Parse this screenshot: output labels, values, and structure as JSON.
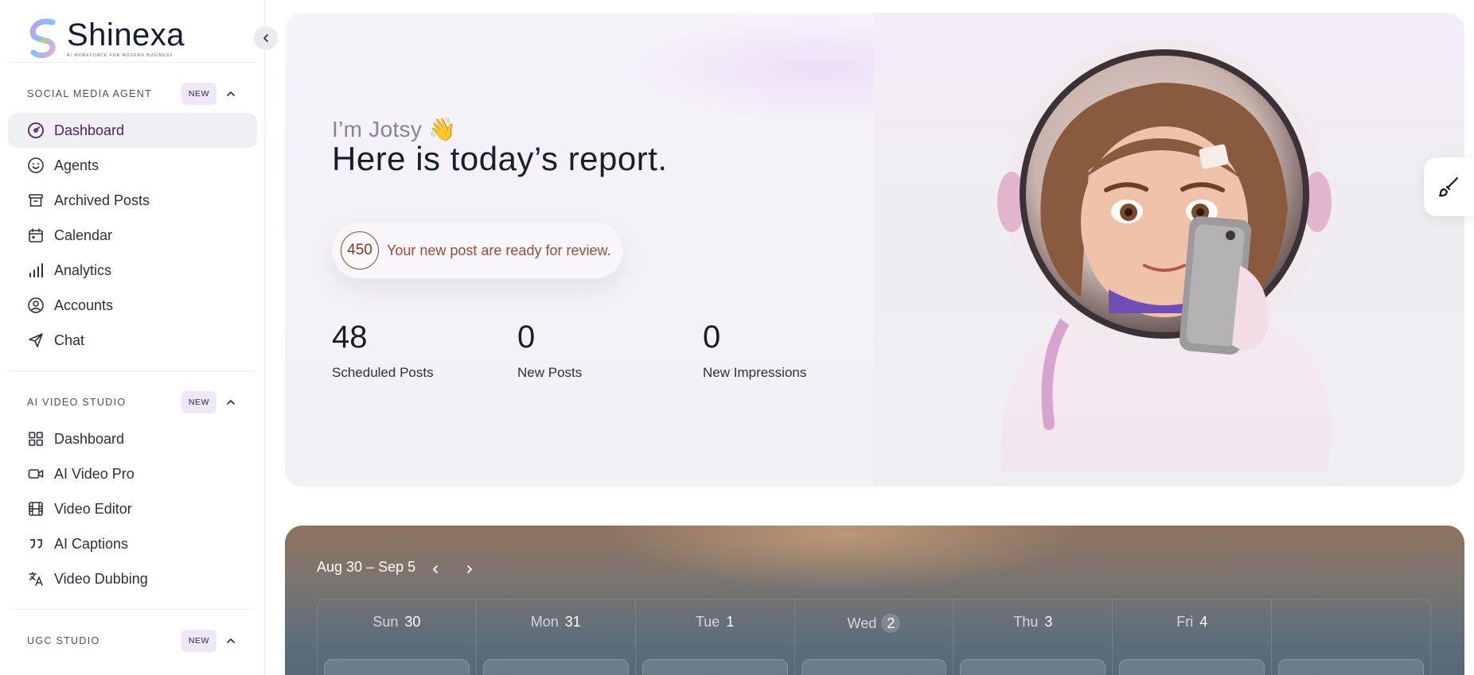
{
  "brand": {
    "name": "Shinexa",
    "tagline": "AI WORKFORCE FOR MODERN BUSINESS"
  },
  "sidebar": {
    "sections": [
      {
        "title": "SOCIAL MEDIA AGENT",
        "badge": "NEW",
        "items": [
          {
            "label": "Dashboard",
            "icon": "gauge-icon",
            "active": true
          },
          {
            "label": "Agents",
            "icon": "smiley-icon"
          },
          {
            "label": "Archived Posts",
            "icon": "archive-icon"
          },
          {
            "label": "Calendar",
            "icon": "calendar-icon"
          },
          {
            "label": "Analytics",
            "icon": "bar-chart-icon"
          },
          {
            "label": "Accounts",
            "icon": "user-circle-icon"
          },
          {
            "label": "Chat",
            "icon": "send-icon"
          }
        ]
      },
      {
        "title": "AI VIDEO STUDIO",
        "badge": "NEW",
        "items": [
          {
            "label": "Dashboard",
            "icon": "grid-icon"
          },
          {
            "label": "AI Video Pro",
            "icon": "video-icon"
          },
          {
            "label": "Video Editor",
            "icon": "film-icon"
          },
          {
            "label": "AI Captions",
            "icon": "quote-icon"
          },
          {
            "label": "Video Dubbing",
            "icon": "translate-icon"
          }
        ]
      },
      {
        "title": "UGC STUDIO",
        "badge": "NEW",
        "items": []
      }
    ]
  },
  "hero": {
    "greeting": "I’m Jotsy",
    "wave": "👋",
    "headline": "Here is today’s report.",
    "review_count": "450",
    "review_text": "Your new post are ready for review.",
    "stats": [
      {
        "value": "48",
        "label": "Scheduled Posts"
      },
      {
        "value": "0",
        "label": "New Posts"
      },
      {
        "value": "0",
        "label": "New Impressions"
      }
    ]
  },
  "calendar": {
    "range": "Aug 30 – Sep 5",
    "days": [
      {
        "name": "Sun",
        "num": "30"
      },
      {
        "name": "Mon",
        "num": "31"
      },
      {
        "name": "Tue",
        "num": "1"
      },
      {
        "name": "Wed",
        "num": "2",
        "today": true
      },
      {
        "name": "Thu",
        "num": "3"
      },
      {
        "name": "Fri",
        "num": "4"
      },
      {
        "name": "",
        "num": ""
      }
    ]
  },
  "colors": {
    "accent": "#4b1f73",
    "badge_bg": "#efe6f8",
    "review_text": "#9a4d34"
  }
}
